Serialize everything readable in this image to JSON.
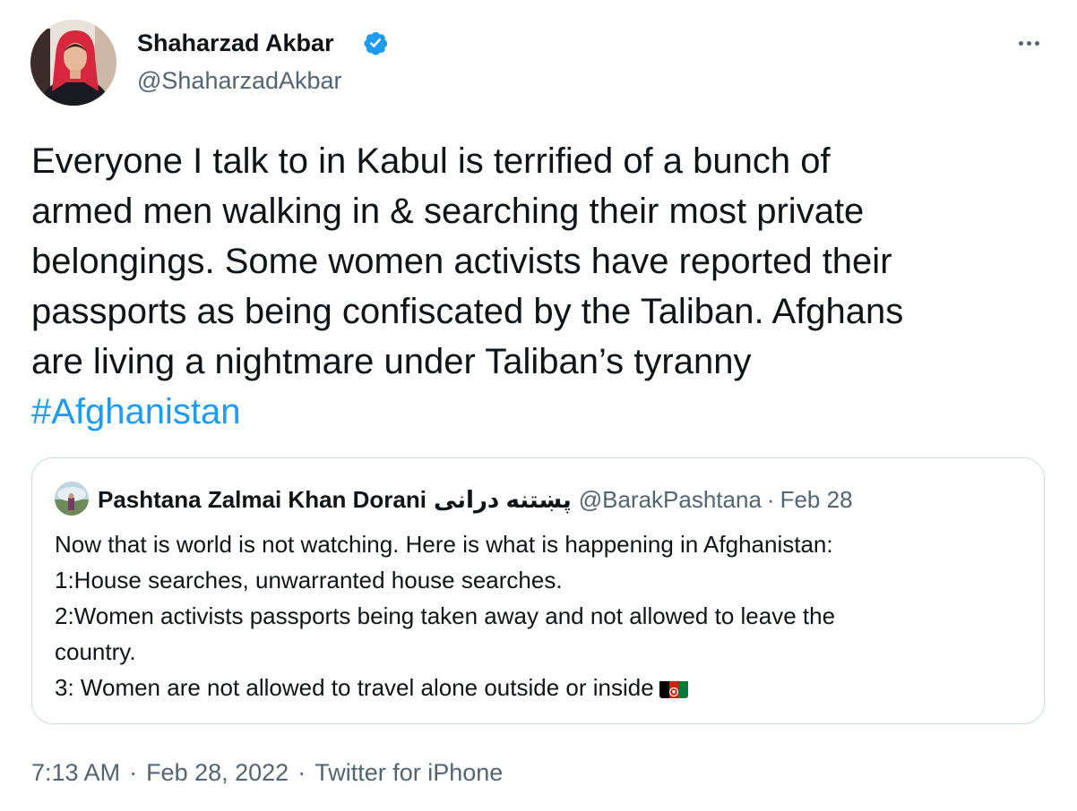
{
  "author": {
    "name": "Shaharzad Akbar",
    "handle": "@ShaharzadAkbar",
    "verified": true
  },
  "tweet": {
    "lines": [
      "Everyone I talk to in Kabul is terrified of a bunch of",
      "armed men walking in & searching their most private",
      "belongings. Some women activists have reported their",
      "passports as being confiscated by the Taliban. Afghans",
      "are living a nightmare under Taliban’s tyranny"
    ],
    "hashtag": "#Afghanistan"
  },
  "quoted": {
    "name": "Pashtana Zalmai Khan Dorani",
    "name_rtl": "پښتنه درانی",
    "handle": "@BarakPashtana",
    "separator": "·",
    "date": "Feb 28",
    "lines": [
      "Now that is world is not watching. Here is what is happening in Afghanistan:",
      "1:House searches, unwarranted house searches.",
      "2:Women activists passports being taken away and not allowed to leave the",
      "country.",
      "3: Women are not allowed to travel alone outside or inside"
    ],
    "emoji": "afghanistan-flag"
  },
  "meta": {
    "time": "7:13 AM",
    "date": "Feb 28, 2022",
    "source": "Twitter for iPhone",
    "separator": "·"
  },
  "colors": {
    "link": "#1d9bf0",
    "secondary_text": "#536471",
    "border": "#cfd9de"
  }
}
